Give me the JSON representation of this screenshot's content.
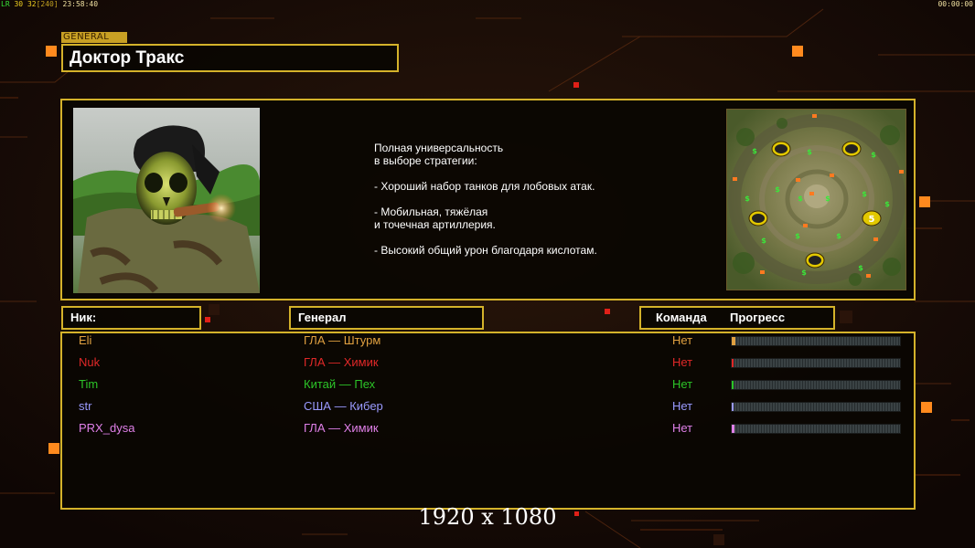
{
  "hud": {
    "left_status": [
      "LR",
      "30",
      "32",
      "[240]",
      "23:58:40"
    ],
    "right_time": "00:00:00"
  },
  "general_tag": "GENERAL",
  "general_name": "Доктор Тракс",
  "description": [
    "Полная универсальность",
    "в выборе стратегии:",
    "",
    "- Хороший набор танков для лобовых атак.",
    "",
    "- Мобильная, тяжёлая",
    "и точечная артиллерия.",
    "",
    "- Высокий общий урон благодаря кислотам."
  ],
  "map": {
    "start_marker_label": "5",
    "resource_symbol": "$"
  },
  "table_headers": {
    "nick": "Ник:",
    "general": "Генерал",
    "team": "Команда",
    "progress": "Прогресс"
  },
  "players": [
    {
      "nick": "Eli",
      "general": "ГЛА — Штурм",
      "team": "Нет",
      "color": "#e0a040",
      "progress": 0.02
    },
    {
      "nick": "Nuk",
      "general": "ГЛА — Химик",
      "team": "Нет",
      "color": "#e02828",
      "progress": 0.01
    },
    {
      "nick": "Tim",
      "general": "Китай — Пех",
      "team": "Нет",
      "color": "#2cc428",
      "progress": 0.005
    },
    {
      "nick": "str",
      "general": "США — Кибер",
      "team": "Нет",
      "color": "#9a9aff",
      "progress": 0.005
    },
    {
      "nick": "PRX_dysa",
      "general": "ГЛА — Химик",
      "team": "Нет",
      "color": "#e080e8",
      "progress": 0.015
    }
  ],
  "resolution_caption": "1920 x 1080",
  "colors": {
    "accent": "#d4b22a",
    "background": "#140a06",
    "hud_orange": "#ff8a1e"
  }
}
